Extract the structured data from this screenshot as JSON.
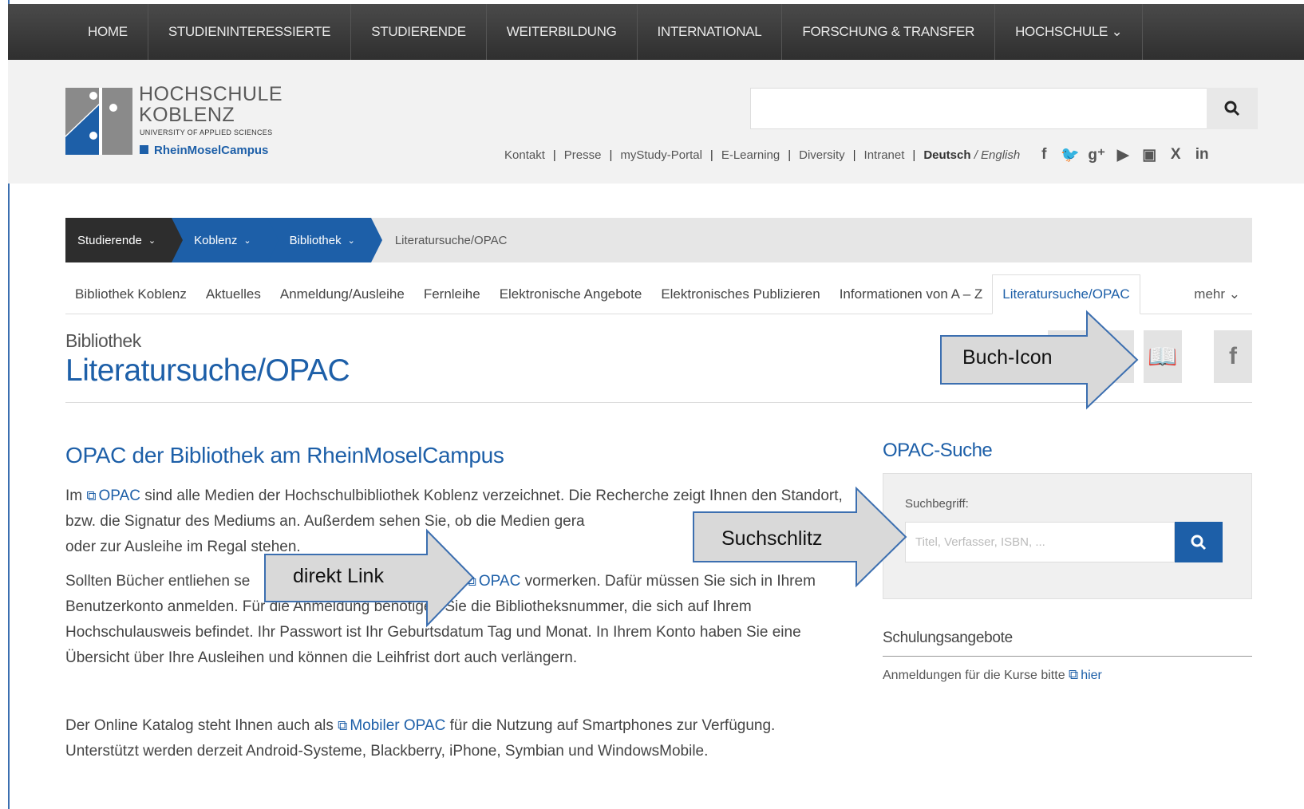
{
  "topnav": [
    "HOME",
    "STUDIENINTERESSIERTE",
    "STUDIERENDE",
    "WEITERBILDUNG",
    "INTERNATIONAL",
    "FORSCHUNG & TRANSFER",
    "HOCHSCHULE"
  ],
  "logo": {
    "line1": "HOCHSCHULE",
    "line2": "KOBLENZ",
    "line3": "UNIVERSITY OF APPLIED SCIENCES",
    "line4": "RheinMoselCampus"
  },
  "utility": [
    "Kontakt",
    "Presse",
    "myStudy-Portal",
    "E-Learning",
    "Diversity",
    "Intranet"
  ],
  "lang": {
    "de": "Deutsch",
    "sep": "/",
    "en": "English"
  },
  "breadcrumb": [
    "Studierende",
    "Koblenz",
    "Bibliothek",
    "Literatursuche/OPAC"
  ],
  "subnav": [
    "Bibliothek Koblenz",
    "Aktuelles",
    "Anmeldung/Ausleihe",
    "Fernleihe",
    "Elektronische Angebote",
    "Elektronisches Publizieren",
    "Informationen von A – Z",
    "Literatursuche/OPAC"
  ],
  "subnav_more": "mehr",
  "section_label": "Bibliothek",
  "page_title": "Literatursuche/OPAC",
  "content": {
    "heading": "OPAC der Bibliothek am RheinMoselCampus",
    "p1_a": "Im",
    "p1_link": "OPAC",
    "p1_b": "sind alle Medien der Hochschulbibliothek Koblenz verzeichnet. Die Recherche zeigt Ihnen den Standort, bzw. die Signatur des Mediums an. Außerdem sehen Sie, ob die Medien gera",
    "p1_c": "oder zur Ausleihe im Regal stehen.",
    "p2_a": "Sollten Bücher entliehen se",
    "p2_b": "n",
    "p2_link": "OPAC",
    "p2_c": "vormerken. Dafür müssen Sie sich in Ihrem Benutzerkonto anmelden. Für die Anmeldung benötigen Sie die Bibliotheksnummer, die sich auf Ihrem Hochschulausweis befindet. Ihr Passwort ist Ihr Geburtsdatum Tag und Monat. In Ihrem Konto haben Sie eine Übersicht über Ihre Ausleihen und können die Leihfrist dort auch verlängern.",
    "p3_a": "Der Online Katalog steht Ihnen auch als",
    "p3_link": "Mobiler OPAC",
    "p3_b": "für die Nutzung auf Smartphones zur Verfügung. Unterstützt werden derzeit Android-Systeme, Blackberry, iPhone, Symbian und WindowsMobile."
  },
  "sidebar": {
    "heading": "OPAC-Suche",
    "label": "Suchbegriff:",
    "placeholder": "Titel, Verfasser, ISBN, ...",
    "heading2": "Schulungsangebote",
    "text": "Anmeldungen für die Kurse bitte",
    "link": "hier"
  },
  "callouts": {
    "book": "Buch-Icon",
    "search": "Suchschlitz",
    "link": "direkt Link"
  },
  "colors": {
    "primary": "#1d5fa8",
    "nav": "#3a3a3a",
    "callout_fill": "#d9d9d9",
    "callout_border": "#3c6fb0"
  }
}
